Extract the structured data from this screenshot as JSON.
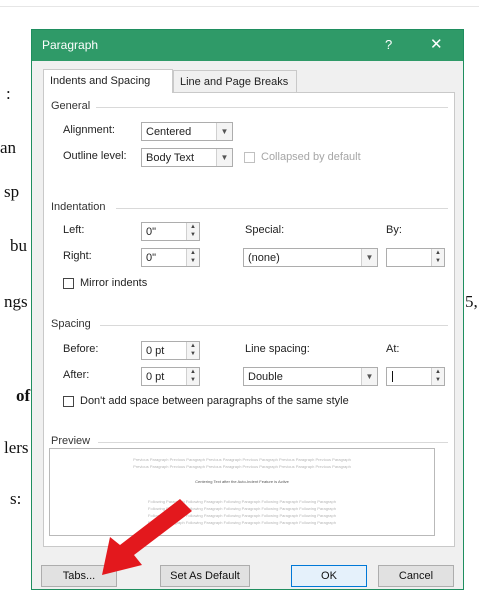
{
  "background": {
    "fragments": [
      ":",
      "an",
      "sp",
      "bu",
      "ngs",
      "5,",
      "of",
      "lers",
      "s:"
    ]
  },
  "dialog": {
    "title": "Paragraph",
    "help": "?",
    "close": "✕",
    "tabs": [
      "Indents and Spacing",
      "Line and Page Breaks"
    ],
    "general": {
      "heading": "General",
      "alignment_label": "Alignment:",
      "alignment_value": "Centered",
      "outline_label": "Outline level:",
      "outline_value": "Body Text",
      "collapsed_label": "Collapsed by default"
    },
    "indentation": {
      "heading": "Indentation",
      "left_label": "Left:",
      "left_value": "0\"",
      "right_label": "Right:",
      "right_value": "0\"",
      "special_label": "Special:",
      "special_value": "(none)",
      "by_label": "By:",
      "by_value": "",
      "mirror_label": "Mirror indents"
    },
    "spacing": {
      "heading": "Spacing",
      "before_label": "Before:",
      "before_value": "0 pt",
      "after_label": "After:",
      "after_value": "0 pt",
      "line_spacing_label": "Line spacing:",
      "line_spacing_value": "Double",
      "at_label": "At:",
      "at_value": "",
      "dont_add_label": "Don't add space between paragraphs of the same style"
    },
    "preview": {
      "heading": "Preview",
      "previous_line": "Previous Paragraph Previous Paragraph Previous Paragraph Previous Paragraph Previous Paragraph Previous Paragraph",
      "current_line": "Centering Text after the Auto-Indent Feature is Active",
      "following_line": "Following Paragraph Following Paragraph Following Paragraph Following Paragraph Following Paragraph"
    },
    "buttons": {
      "tabs": "Tabs...",
      "set_default": "Set As Default",
      "ok": "OK",
      "cancel": "Cancel"
    }
  },
  "colors": {
    "titlebar": "#2f9a68",
    "annotation_arrow": "#e3181d"
  }
}
